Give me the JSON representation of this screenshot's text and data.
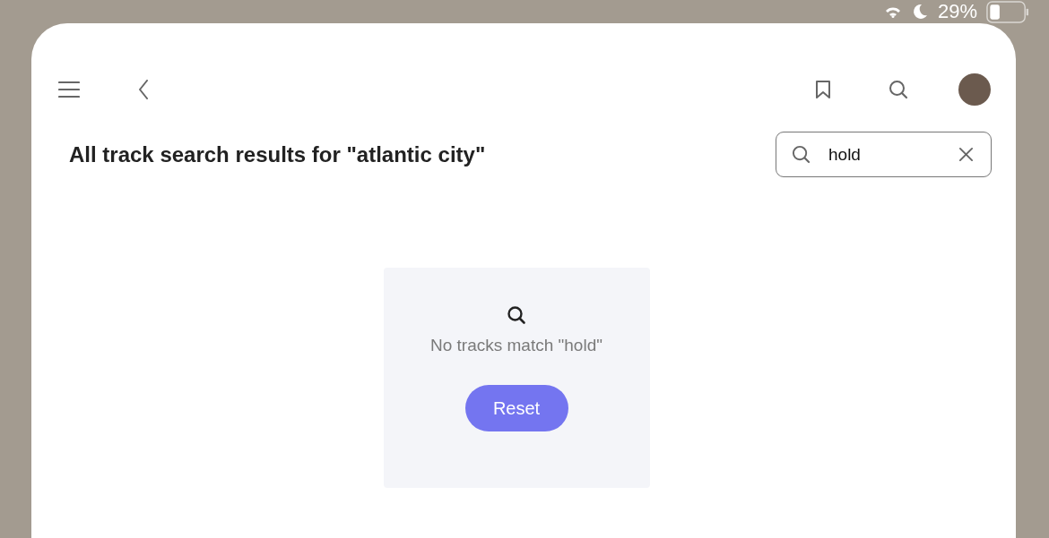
{
  "status_bar": {
    "battery": "29%"
  },
  "page": {
    "title": "All track search results for \"atlantic city\""
  },
  "search": {
    "value": "hold"
  },
  "empty_state": {
    "message": "No tracks match \"hold\"",
    "button": "Reset"
  }
}
